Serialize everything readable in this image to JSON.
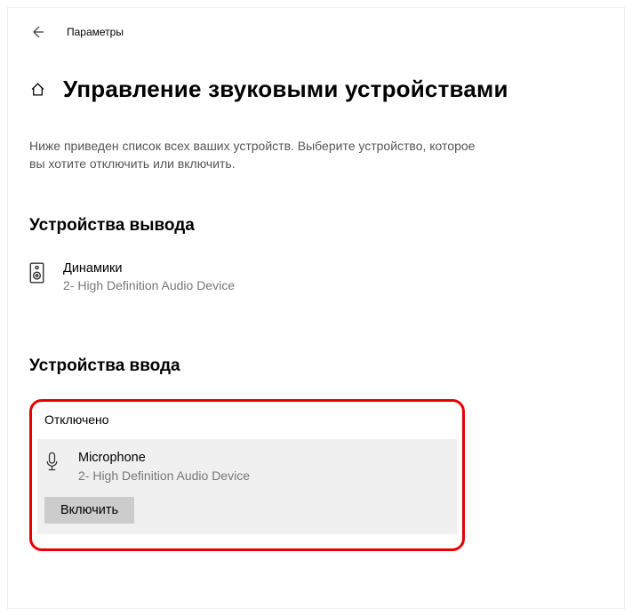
{
  "header": {
    "window_label": "Параметры"
  },
  "title_area": {
    "page_title": "Управление звуковыми устройствами"
  },
  "description": "Ниже приведен список всех ваших устройств. Выберите устройство, которое вы хотите отключить или включить.",
  "sections": {
    "output": {
      "heading": "Устройства вывода",
      "device": {
        "name": "Динамики",
        "sub": "2- High Definition Audio Device"
      }
    },
    "input": {
      "heading": "Устройства ввода",
      "disabled_label": "Отключено",
      "device": {
        "name": "Microphone",
        "sub": "2- High Definition Audio Device"
      },
      "enable_button": "Включить"
    }
  }
}
